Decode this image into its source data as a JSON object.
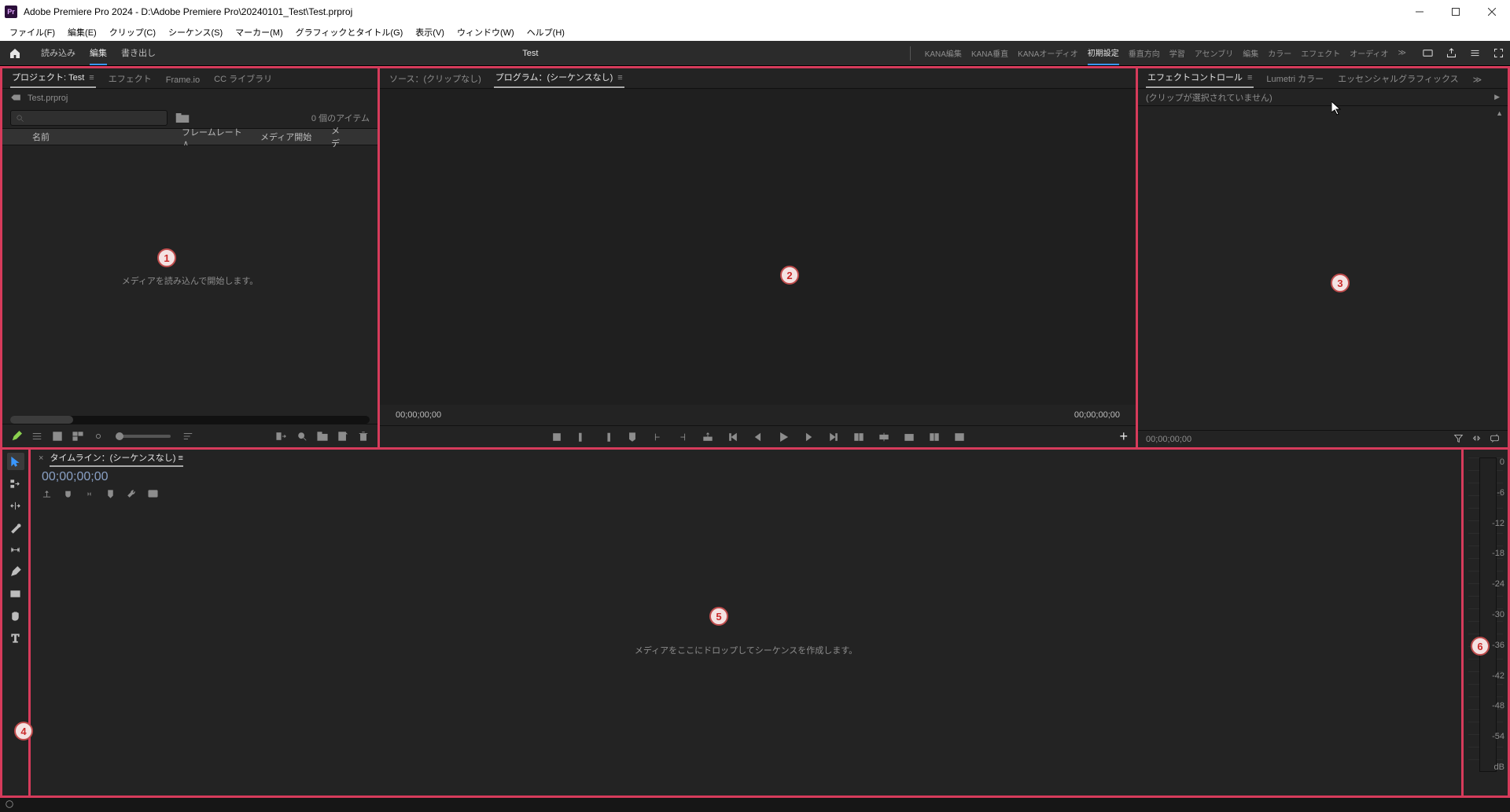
{
  "window": {
    "app_icon_text": "Pr",
    "title": "Adobe Premiere Pro 2024 - D:\\Adobe Premiere Pro\\20240101_Test\\Test.prproj"
  },
  "menu_bar": {
    "items": [
      "ファイル(F)",
      "編集(E)",
      "クリップ(C)",
      "シーケンス(S)",
      "マーカー(M)",
      "グラフィックとタイトル(G)",
      "表示(V)",
      "ウィンドウ(W)",
      "ヘルプ(H)"
    ]
  },
  "app_header": {
    "left_tabs": {
      "items": [
        "読み込み",
        "編集",
        "書き出し"
      ],
      "active": "編集"
    },
    "project_name": "Test",
    "workspaces": {
      "items": [
        "KANA編集",
        "KANA垂直",
        "KANAオーディオ",
        "初期設定",
        "垂直方向",
        "学習",
        "アセンブリ",
        "編集",
        "カラー",
        "エフェクト",
        "オーディオ"
      ],
      "active": "初期設定"
    }
  },
  "project_panel": {
    "tabs": [
      "プロジェクト: Test",
      "エフェクト",
      "Frame.io",
      "CC ライブラリ"
    ],
    "active_tab": "プロジェクト: Test",
    "breadcrumb": "Test.prproj",
    "search_placeholder": "",
    "item_count_label": "0 個のアイテム",
    "columns": {
      "name": "名前",
      "framerate": "フレームレート",
      "media_start": "メディア開始",
      "media_end": "メデ"
    },
    "empty_message": "メディアを読み込んで開始します。"
  },
  "source_monitor": {
    "tabs": [
      "ソース：(クリップなし)",
      "プログラム：(シーケンスなし)"
    ],
    "active_tab": "プログラム：(シーケンスなし)",
    "left_timecode": "00;00;00;00",
    "right_timecode": "00;00;00;00"
  },
  "effect_controls": {
    "tabs": [
      "エフェクトコントロール",
      "Lumetri カラー",
      "エッセンシャルグラフィックス"
    ],
    "active_tab": "エフェクトコントロール",
    "no_clip_label": "(クリップが選択されていません)",
    "footer_timecode": "00;00;00;00"
  },
  "timeline": {
    "tab_label": "タイムライン：(シーケンスなし)",
    "timecode": "00;00;00;00",
    "empty_message": "メディアをここにドロップしてシーケンスを作成します。"
  },
  "audio_meter": {
    "marks": [
      "0",
      "-6",
      "-12",
      "-18",
      "-24",
      "-30",
      "-36",
      "-42",
      "-48",
      "-54",
      "dB"
    ]
  },
  "badges": {
    "b1": "1",
    "b2": "2",
    "b3": "3",
    "b4": "4",
    "b5": "5",
    "b6": "6"
  }
}
